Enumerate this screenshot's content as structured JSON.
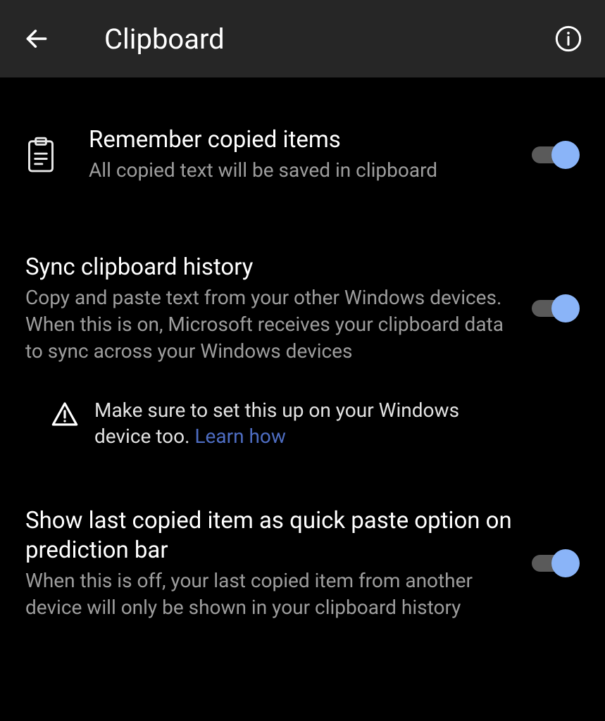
{
  "header": {
    "title": "Clipboard"
  },
  "settings": {
    "remember": {
      "title": "Remember copied items",
      "desc": "All copied text will be saved in clipboard"
    },
    "sync": {
      "title": "Sync clipboard history",
      "desc": "Copy and paste text from your other Windows devices. When this is on, Microsoft receives your clipboard data to sync across your Windows devices",
      "warning": "Make sure to set this up on your Windows device too. ",
      "learn": "Learn how"
    },
    "quickpaste": {
      "title": "Show last copied item as quick paste option on prediction bar",
      "desc": "When this is off, your last copied item from another device will only be shown in your clipboard history"
    }
  }
}
